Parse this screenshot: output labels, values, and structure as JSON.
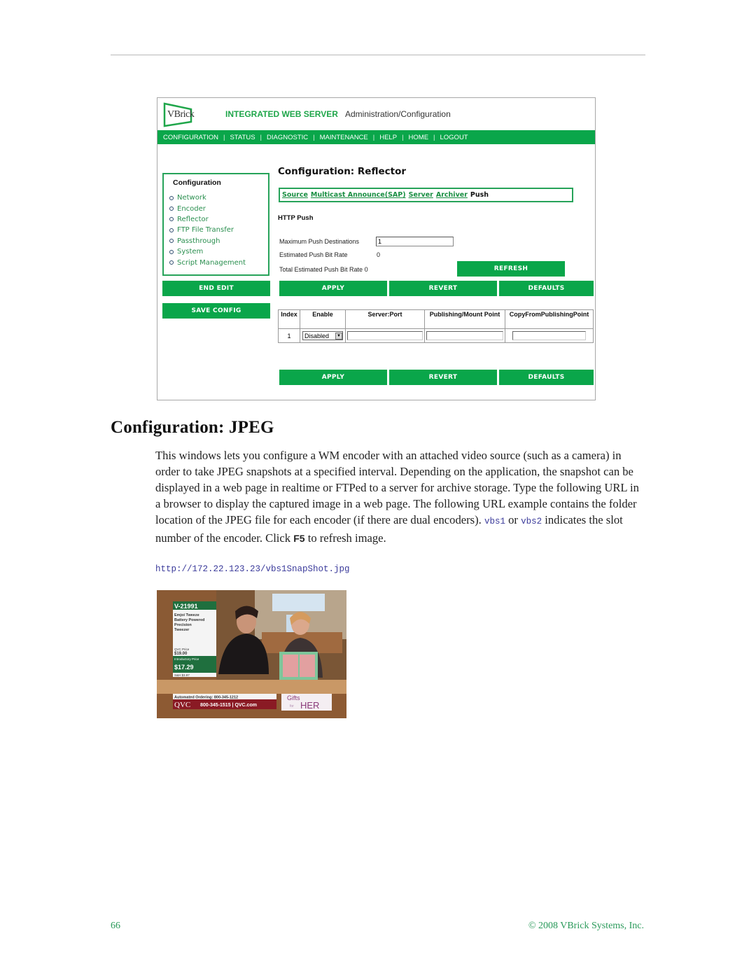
{
  "screenshot": {
    "logo_text": "VBrick",
    "app_title": "INTEGRATED WEB SERVER",
    "app_subtitle": "Administration/Configuration",
    "nav": [
      "CONFIGURATION",
      "STATUS",
      "DIAGNOSTIC",
      "MAINTENANCE",
      "HELP",
      "HOME",
      "LOGOUT"
    ],
    "sidebar": {
      "title": "Configuration",
      "items": [
        "Network",
        "Encoder",
        "Reflector",
        "FTP File Transfer",
        "Passthrough",
        "System",
        "Script Management"
      ],
      "end_edit": "END EDIT",
      "save_config": "SAVE CONFIG"
    },
    "page_title": "Configuration: Reflector",
    "tabs": {
      "links": [
        "Source",
        "Multicast Announce(SAP)",
        "Server",
        "Archiver"
      ],
      "current": "Push"
    },
    "section_title": "HTTP Push",
    "fields": {
      "max_push_label": "Maximum Push Destinations",
      "max_push_value": "1",
      "est_rate_label": "Estimated Push Bit Rate",
      "est_rate_value": "0",
      "total_rate_label": "Total Estimated Push Bit Rate",
      "total_rate_value": "0"
    },
    "buttons": {
      "refresh": "REFRESH",
      "apply": "APPLY",
      "revert": "REVERT",
      "defaults": "DEFAULTS"
    },
    "table": {
      "headers": [
        "Index",
        "Enable",
        "Server:Port",
        "Publishing/Mount Point",
        "CopyFromPublishingPoint"
      ],
      "rows": [
        {
          "index": "1",
          "enable": "Disabled",
          "server_port": "",
          "mount_point": "",
          "copy_from": ""
        }
      ]
    }
  },
  "document": {
    "heading": "Configuration: JPEG",
    "para_part1": "This windows lets you configure a WM encoder with an attached video source (such as a camera) in order to take JPEG snapshots at a specified interval. Depending on the application, the snapshot can be displayed in a web page in realtime or FTPed to a server for archive storage. Type the following URL in a browser to display the captured image in a web page. The following URL example contains the folder location of the JPEG file for each encoder (if there are dual encoders). ",
    "code1": "vbs1",
    "or_word": " or ",
    "code2": "vbs2",
    "para_part2": " indicates the slot number of the encoder. Click ",
    "key": "F5",
    "para_part3": " to refresh image.",
    "url": "http://172.22.123.23/vbs1SnapShot.jpg"
  },
  "snapshot": {
    "sku": "V-21991",
    "product_lines": [
      "Emjoi Tweeze",
      "Battery Powered",
      "Precision",
      "Tweezer"
    ],
    "qvc_price_label": "QVC Price",
    "qvc_price": "$19.00",
    "intro_label": "Introductory Price",
    "intro_price": "$17.29",
    "sh": "S&H $3.97",
    "auto_order": "Automated Ordering: 800-345-1212",
    "brand": "QVC",
    "phone": "800-345-1515 | QVC.com",
    "promo_top": "Gifts",
    "promo_mid": "for",
    "promo_bottom": "HER"
  },
  "footer": {
    "page_number": "66",
    "copyright": "© 2008 VBrick Systems, Inc."
  }
}
